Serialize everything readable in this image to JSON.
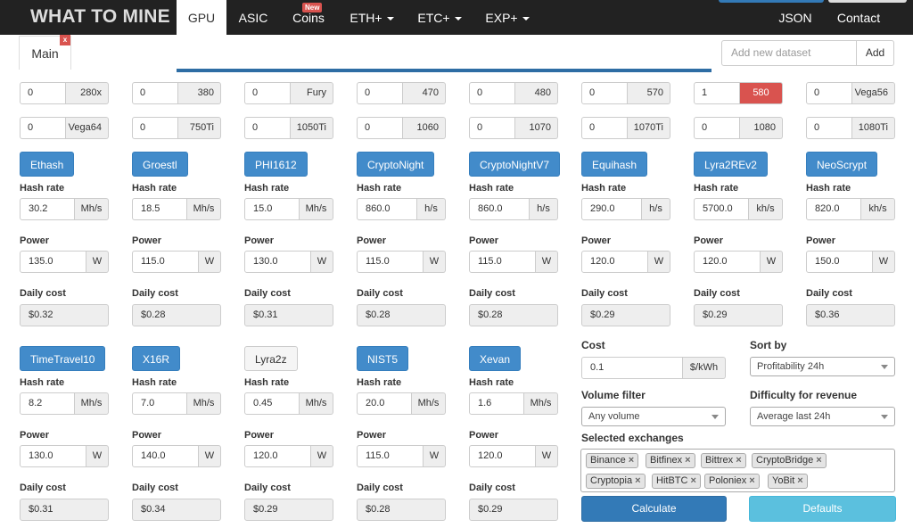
{
  "nav": {
    "brand": "WHAT TO MINE",
    "items": [
      {
        "label": "GPU"
      },
      {
        "label": "ASIC"
      },
      {
        "label": "Coins",
        "badge": "New"
      },
      {
        "label": "ETH+"
      },
      {
        "label": "ETC+"
      },
      {
        "label": "EXP+"
      },
      {
        "label": "JSON"
      },
      {
        "label": "Contact"
      }
    ]
  },
  "tabs": {
    "main_label": "Main",
    "close_label": "x",
    "dataset_placeholder": "Add new dataset",
    "add_label": "Add"
  },
  "gpu_counts": [
    {
      "value": "0",
      "label": "280x"
    },
    {
      "value": "0",
      "label": "380"
    },
    {
      "value": "0",
      "label": "Fury"
    },
    {
      "value": "0",
      "label": "470"
    },
    {
      "value": "0",
      "label": "480"
    },
    {
      "value": "0",
      "label": "570"
    },
    {
      "value": "1",
      "label": "580",
      "highlighted": true
    },
    {
      "value": "0",
      "label": "Vega56"
    },
    {
      "value": "0",
      "label": "Vega64"
    },
    {
      "value": "0",
      "label": "750Ti"
    },
    {
      "value": "0",
      "label": "1050Ti"
    },
    {
      "value": "0",
      "label": "1060"
    },
    {
      "value": "0",
      "label": "1070"
    },
    {
      "value": "0",
      "label": "1070Ti"
    },
    {
      "value": "0",
      "label": "1080"
    },
    {
      "value": "0",
      "label": "1080Ti"
    }
  ],
  "labels": {
    "hash_rate": "Hash rate",
    "power": "Power",
    "daily_cost": "Daily cost",
    "power_unit": "W"
  },
  "algorithms": [
    {
      "name": "Ethash",
      "enabled": true,
      "hashrate": "30.2",
      "unit": "Mh/s",
      "power": "135.0",
      "cost": "$0.32"
    },
    {
      "name": "Groestl",
      "enabled": true,
      "hashrate": "18.5",
      "unit": "Mh/s",
      "power": "115.0",
      "cost": "$0.28"
    },
    {
      "name": "PHI1612",
      "enabled": true,
      "hashrate": "15.0",
      "unit": "Mh/s",
      "power": "130.0",
      "cost": "$0.31"
    },
    {
      "name": "CryptoNight",
      "enabled": true,
      "hashrate": "860.0",
      "unit": "h/s",
      "power": "115.0",
      "cost": "$0.28"
    },
    {
      "name": "CryptoNightV7",
      "enabled": true,
      "hashrate": "860.0",
      "unit": "h/s",
      "power": "115.0",
      "cost": "$0.28"
    },
    {
      "name": "Equihash",
      "enabled": true,
      "hashrate": "290.0",
      "unit": "h/s",
      "power": "120.0",
      "cost": "$0.29"
    },
    {
      "name": "Lyra2REv2",
      "enabled": true,
      "hashrate": "5700.0",
      "unit": "kh/s",
      "power": "120.0",
      "cost": "$0.29"
    },
    {
      "name": "NeoScrypt",
      "enabled": true,
      "hashrate": "820.0",
      "unit": "kh/s",
      "power": "150.0",
      "cost": "$0.36"
    },
    {
      "name": "TimeTravel10",
      "enabled": true,
      "hashrate": "8.2",
      "unit": "Mh/s",
      "power": "130.0",
      "cost": "$0.31"
    },
    {
      "name": "X16R",
      "enabled": true,
      "hashrate": "7.0",
      "unit": "Mh/s",
      "power": "140.0",
      "cost": "$0.34"
    },
    {
      "name": "Lyra2z",
      "enabled": false,
      "hashrate": "0.45",
      "unit": "Mh/s",
      "power": "120.0",
      "cost": "$0.29"
    },
    {
      "name": "NIST5",
      "enabled": true,
      "hashrate": "20.0",
      "unit": "Mh/s",
      "power": "115.0",
      "cost": "$0.28"
    },
    {
      "name": "Xevan",
      "enabled": true,
      "hashrate": "1.6",
      "unit": "Mh/s",
      "power": "120.0",
      "cost": "$0.29"
    }
  ],
  "settings": {
    "cost_label": "Cost",
    "cost_value": "0.1",
    "cost_unit": "$/kWh",
    "sort_label": "Sort by",
    "sort_value": "Profitability 24h",
    "volume_label": "Volume filter",
    "volume_value": "Any volume",
    "difficulty_label": "Difficulty for revenue",
    "difficulty_value": "Average last 24h",
    "exchanges_label": "Selected exchanges",
    "exchanges": [
      "Binance",
      "Bitfinex",
      "Bittrex",
      "CryptoBridge",
      "Cryptopia",
      "HitBTC",
      "Poloniex",
      "YoBit"
    ],
    "chip_remove": "×",
    "calculate_label": "Calculate",
    "defaults_label": "Defaults"
  },
  "colors": {
    "navbar": "#222222",
    "primary": "#337ab7",
    "algo_active": "#428bca",
    "highlight": "#d9534f",
    "info": "#5bc0de"
  }
}
